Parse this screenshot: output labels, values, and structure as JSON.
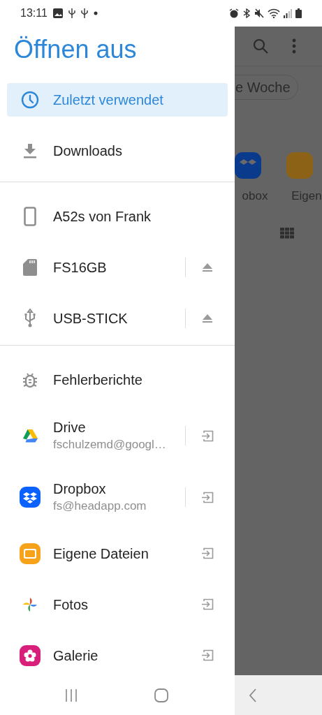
{
  "status_bar": {
    "time": "13:11"
  },
  "drawer": {
    "title": "Öffnen aus",
    "sections": [
      {
        "items": [
          {
            "kind": "recent",
            "label": "Zuletzt verwendet",
            "selected": true
          },
          {
            "kind": "download",
            "label": "Downloads",
            "selected": false
          }
        ]
      },
      {
        "items": [
          {
            "kind": "phone",
            "label": "A52s von Frank",
            "selected": false
          },
          {
            "kind": "sdcard",
            "label": "FS16GB",
            "selected": false,
            "action": {
              "kind": "eject",
              "divider": true
            }
          },
          {
            "kind": "usb",
            "label": "USB-STICK",
            "selected": false,
            "action": {
              "kind": "eject",
              "divider": true
            }
          }
        ]
      },
      {
        "items": [
          {
            "kind": "bug",
            "label": "Fehlerberichte",
            "selected": false
          },
          {
            "kind": "drive",
            "label": "Drive",
            "subtitle": "fschulzemd@googl…",
            "selected": false,
            "action": {
              "kind": "open",
              "divider": true
            }
          },
          {
            "kind": "dropbox",
            "label": "Dropbox",
            "subtitle": "fs@headapp.com",
            "selected": false,
            "action": {
              "kind": "open",
              "divider": true
            }
          },
          {
            "kind": "folder",
            "label": "Eigene Dateien",
            "selected": false,
            "action": {
              "kind": "open",
              "divider": false
            }
          },
          {
            "kind": "photos",
            "label": "Fotos",
            "selected": false,
            "action": {
              "kind": "open",
              "divider": false
            }
          },
          {
            "kind": "gallery",
            "label": "Galerie",
            "selected": false,
            "action": {
              "kind": "open",
              "divider": false
            }
          }
        ]
      }
    ]
  },
  "background_screen": {
    "chip": "e Woche",
    "shortcuts": [
      {
        "kind": "dropbox",
        "label": "obox"
      },
      {
        "kind": "folder",
        "label": "Eigen"
      }
    ]
  }
}
